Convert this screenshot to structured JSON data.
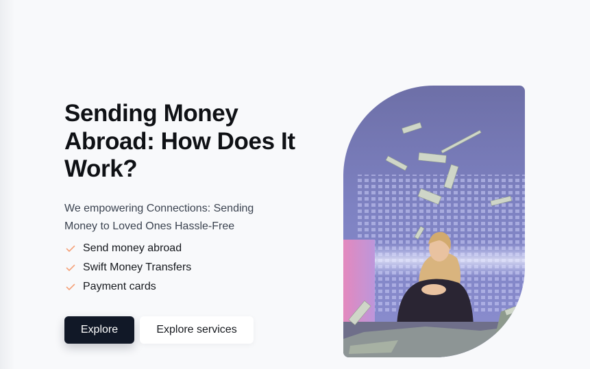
{
  "hero": {
    "title": "Sending Money Abroad: How Does It Work?",
    "subtitle": "We empowering Connections: Sending Money to Loved Ones Hassle-Free",
    "features": [
      "Send money abroad",
      "Swift Money Transfers",
      "Payment cards"
    ],
    "check_icon": "check-icon",
    "accent_color": "#f4a27a",
    "buttons": {
      "primary": "Explore",
      "secondary": "Explore services"
    },
    "image_icon": "woman-with-flying-money-photo"
  }
}
